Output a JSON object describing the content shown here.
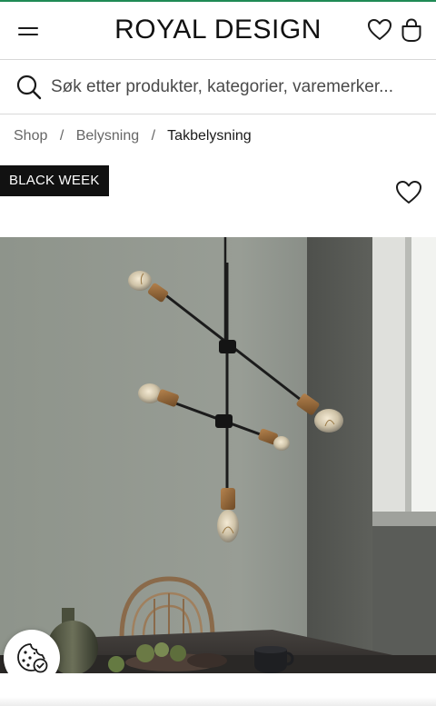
{
  "header": {
    "brand": "ROYAL DESIGN",
    "menu_icon": "hamburger-menu-icon",
    "wishlist_icon": "heart-icon",
    "bag_icon": "shopping-bag-icon"
  },
  "search": {
    "placeholder": "Søk etter produkter, kategorier, varemerker...",
    "icon": "search-icon"
  },
  "breadcrumb": {
    "items": [
      {
        "label": "Shop"
      },
      {
        "label": "Belysning"
      },
      {
        "label": "Takbelysning"
      }
    ],
    "separator": "/"
  },
  "product": {
    "badge": "BLACK WEEK",
    "wishlist_icon": "heart-icon",
    "image_icon": "pendant-lamp-photo"
  },
  "cookie": {
    "icon": "cookie-settings-icon"
  },
  "colors": {
    "accent_line": "#1f8a55",
    "badge_bg": "#111111",
    "wall": "#8f958c",
    "table": "#3a3634"
  }
}
